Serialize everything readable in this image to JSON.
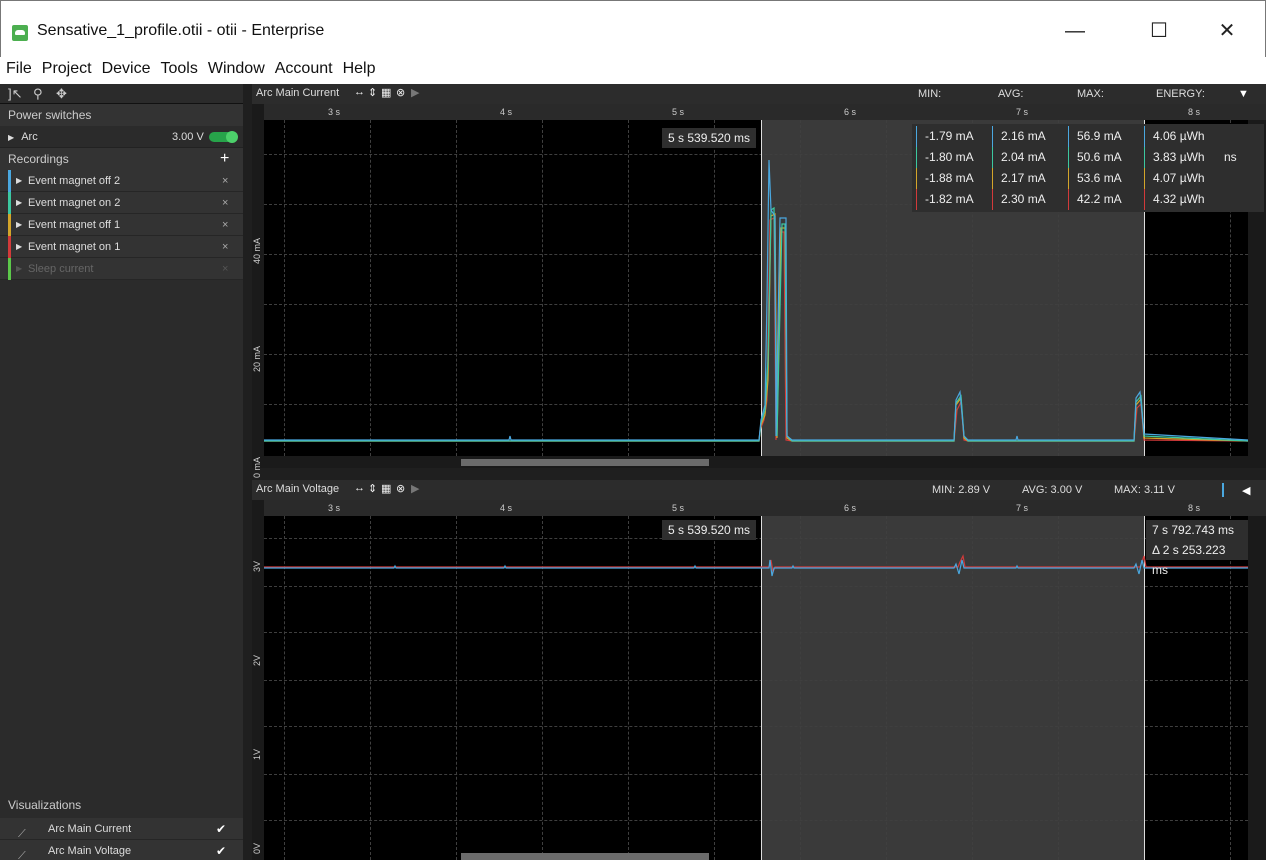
{
  "window": {
    "title": "Sensative_1_profile.otii - otii - Enterprise",
    "controls": {
      "minimize": "—",
      "maximize": "☐",
      "close": "✕"
    }
  },
  "menu": [
    "File",
    "Project",
    "Device",
    "Tools",
    "Window",
    "Account",
    "Help"
  ],
  "sidebar": {
    "power_switches": {
      "header": "Power switches",
      "arc": {
        "label": "Arc",
        "voltage": "3.00 V",
        "on": true
      }
    },
    "recordings": {
      "header": "Recordings",
      "add_symbol": "+",
      "items": [
        {
          "label": "Event magnet off 2",
          "color": "#4aa8e0",
          "dimmed": false
        },
        {
          "label": "Event magnet on 2",
          "color": "#3cc8a0",
          "dimmed": false
        },
        {
          "label": "Event magnet off 1",
          "color": "#d4a52a",
          "dimmed": false
        },
        {
          "label": "Event magnet on 1",
          "color": "#d23a3a",
          "dimmed": false
        },
        {
          "label": "Sleep current",
          "color": "#5cc84a",
          "dimmed": true
        }
      ],
      "close_symbol": "×"
    },
    "visualizations": {
      "header": "Visualizations",
      "items": [
        {
          "label": "Arc Main Current",
          "checked": "✔"
        },
        {
          "label": "Arc Main Voltage",
          "checked": "✔"
        }
      ]
    }
  },
  "current_panel": {
    "title": "Arc Main Current",
    "header_stats": {
      "min": "MIN:",
      "avg": "AVG:",
      "max": "MAX:",
      "energy": "ENERGY:"
    },
    "ticks": [
      "3 s",
      "4 s",
      "5 s",
      "6 s",
      "7 s",
      "8 s"
    ],
    "y_labels": [
      "40 mA",
      "20 mA",
      "0 mA"
    ],
    "marker_left": "5 s 539.520 ms",
    "marker_right_fragment": "ns",
    "stats_rows": [
      {
        "min": "-1.79 mA",
        "avg": "2.16 mA",
        "max": "56.9 mA",
        "energy": "4.06 µWh",
        "color": "#4aa8e0"
      },
      {
        "min": "-1.80 mA",
        "avg": "2.04 mA",
        "max": "50.6 mA",
        "energy": "3.83 µWh",
        "color": "#3cc8a0"
      },
      {
        "min": "-1.88 mA",
        "avg": "2.17 mA",
        "max": "53.6 mA",
        "energy": "4.07 µWh",
        "color": "#d4a52a"
      },
      {
        "min": "-1.82 mA",
        "avg": "2.30 mA",
        "max": "42.2 mA",
        "energy": "4.32 µWh",
        "color": "#d23a3a"
      }
    ]
  },
  "voltage_panel": {
    "title": "Arc Main Voltage",
    "min": "MIN: 2.89 V",
    "avg": "AVG: 3.00 V",
    "max": "MAX: 3.11 V",
    "ticks": [
      "3 s",
      "4 s",
      "5 s",
      "6 s",
      "7 s",
      "8 s"
    ],
    "y_labels": [
      "3V",
      "2V",
      "1V",
      "0V"
    ],
    "marker_left": "5 s 539.520 ms",
    "marker_right": "7 s 792.743 ms",
    "delta": "Δ 2 s 253.223 ms"
  },
  "toolbar_icons": [
    "cursor-select-icon",
    "zoom-icon",
    "pan-icon"
  ]
}
